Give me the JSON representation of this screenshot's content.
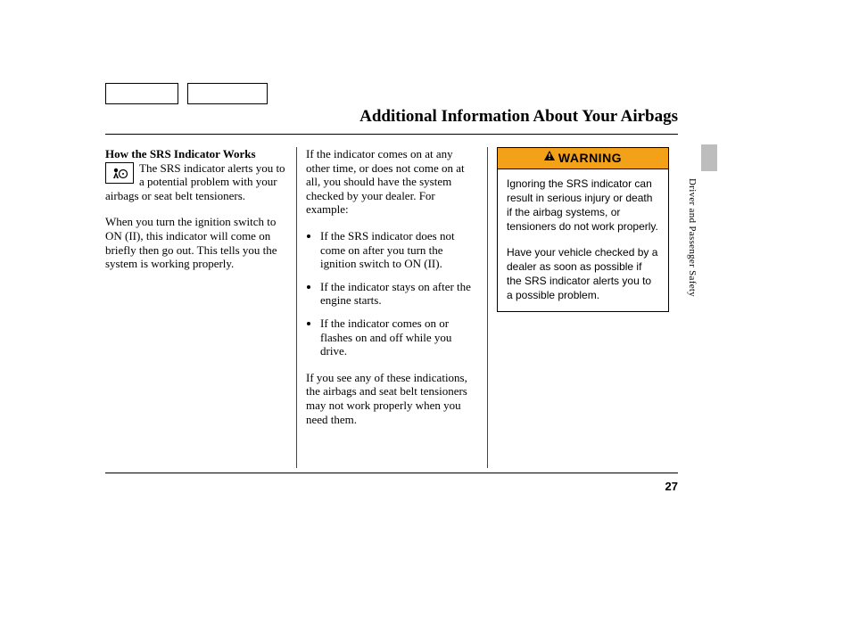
{
  "title": "Additional Information About Your Airbags",
  "side_label": "Driver and Passenger Safety",
  "page_number": "27",
  "col1": {
    "heading": "How the SRS Indicator Works",
    "intro": "The SRS indicator alerts you to a potential problem with your airbags or seat belt tensioners.",
    "para2": "When you turn the ignition switch to ON (II), this indicator will come on briefly then go out. This tells you the system is working properly."
  },
  "col2": {
    "intro": "If the indicator comes on at any other time, or does not come on at all, you should have the system checked by your dealer. For example:",
    "b1": "If the SRS indicator does not come on after you turn the ignition switch to ON (II).",
    "b2": "If the indicator stays on after the engine starts.",
    "b3": "If the indicator comes on or flashes on and off while you drive.",
    "outro": "If you see any of these indications, the airbags and seat belt tensioners may not work properly when you need them."
  },
  "warning": {
    "header": "WARNING",
    "p1": "Ignoring the SRS indicator can result in serious injury or death if the airbag systems, or tensioners do not work properly.",
    "p2": "Have your vehicle checked by a dealer as soon as possible if the SRS indicator alerts you to a possible problem."
  }
}
